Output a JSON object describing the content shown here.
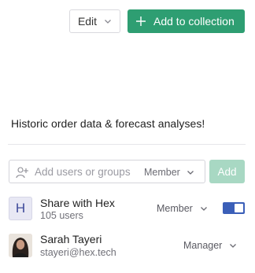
{
  "toolbar": {
    "edit_label": "Edit",
    "add_to_collection_label": "Add to collection",
    "accent_color": "#2e9e72"
  },
  "description": "Historic order data & forecast analyses!",
  "invite": {
    "placeholder": "Add users or groups",
    "role": "Member",
    "add_label": "Add",
    "add_button_color": "#a8d8c3"
  },
  "members": [
    {
      "avatar_letter": "H",
      "name": "Share with Hex",
      "subtitle": "105 users",
      "role": "Member",
      "toggle_on": true,
      "toggle_color": "#3b5fb8"
    },
    {
      "avatar": "photo",
      "name": "Sarah Tayeri",
      "subtitle": "stayeri@hex.tech",
      "role": "Manager"
    }
  ]
}
